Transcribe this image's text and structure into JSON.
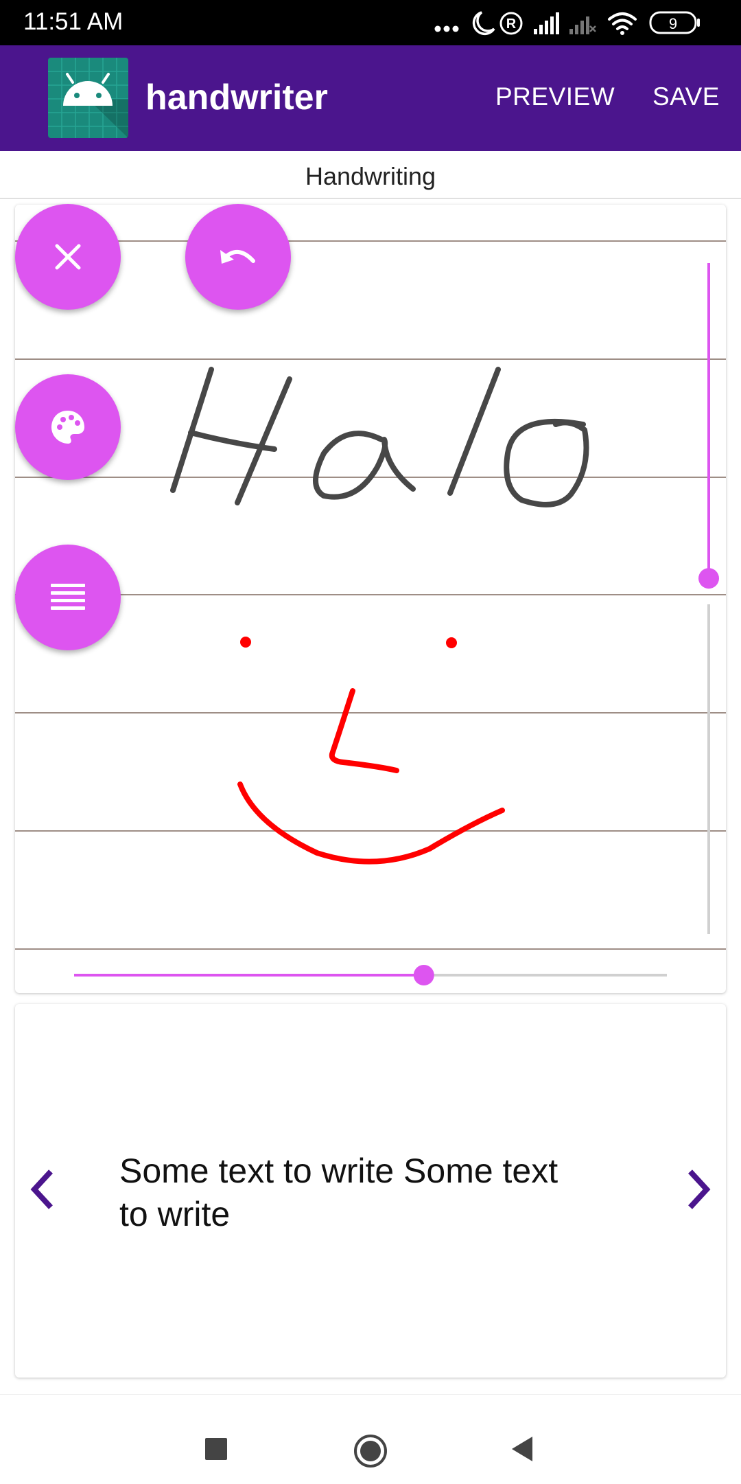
{
  "status_bar": {
    "time": "11:51 AM",
    "battery": "9",
    "icons": [
      "more-dots-icon",
      "moon-icon",
      "registered-icon",
      "signal-icon",
      "signal-off-icon",
      "wifi-icon",
      "battery-icon"
    ]
  },
  "app_bar": {
    "title": "handwriter",
    "preview_label": "PREVIEW",
    "save_label": "SAVE",
    "logo_icon": "android-logo-icon"
  },
  "tab": {
    "label": "Handwriting"
  },
  "canvas": {
    "fab_icons": [
      "close-icon",
      "undo-icon",
      "palette-icon",
      "lines-menu-icon"
    ],
    "handwritten_word": "Halo",
    "ink_colors": {
      "word": "#474747",
      "face": "#ff0000"
    },
    "vertical_slider_value": 0.53,
    "horizontal_slider_value": 0.59,
    "accent_color": "#dd55f0",
    "ruled_line_color": "#9e8e86"
  },
  "prompt": {
    "text": "Some text to write Some text to write",
    "prev_icon": "chevron-left-icon",
    "next_icon": "chevron-right-icon",
    "arrow_color": "#4b158d"
  },
  "nav_bar": {
    "icons": [
      "recents-square-icon",
      "home-circle-icon",
      "back-triangle-icon"
    ]
  }
}
